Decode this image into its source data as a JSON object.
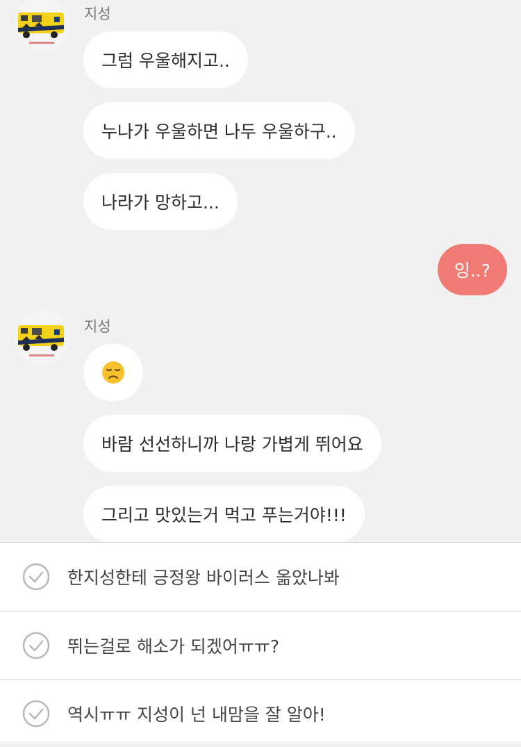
{
  "chat": {
    "messages": [
      {
        "sender": "지성"
      },
      {
        "text": "그럼 우울해지고.."
      },
      {
        "text": "누나가 우울하면 나두 우울하구.."
      },
      {
        "text": "나라가 망하고..."
      },
      {
        "text": "잉..?"
      },
      {
        "sender": "지성"
      },
      {
        "emoji": "disappointed-face"
      },
      {
        "text": "바람 선선하니까 나랑 가볍게 뛰어요"
      },
      {
        "text": "그리고 맛있는거 먹고 푸는거야!!!"
      }
    ]
  },
  "options": [
    {
      "label": "한지성한테 긍정왕 바이러스 옮았나봐"
    },
    {
      "label": "뛰는걸로 해소가 되겠어ㅠㅠ?"
    },
    {
      "label": "역시ㅠㅠ 지성이 넌 내맘을 잘 알아!"
    }
  ],
  "colors": {
    "chat_background": "#f2f1f2",
    "received_bubble": "#ffffff",
    "sent_bubble": "#f07b74",
    "check_icon": "#b8b8b8"
  },
  "icons": {
    "avatar": "ambulance-toy-avatar",
    "emoji": "disappointed-face-emoji",
    "option_check": "circle-check-icon"
  }
}
